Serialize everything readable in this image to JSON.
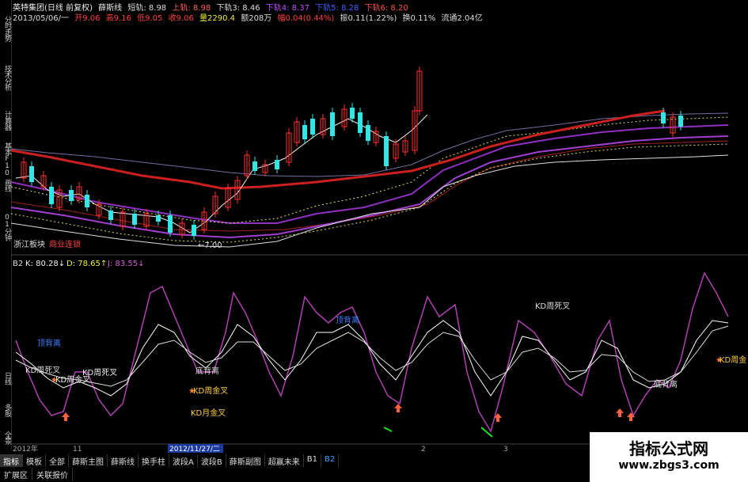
{
  "sidebar": [
    "分时走势",
    "技术分析",
    "计算器",
    "基本F10",
    "画线",
    "01分钟",
    "日线",
    "多股",
    "全景"
  ],
  "header": {
    "line1": [
      "英特集团(日线 前复权)",
      "薛斯线",
      "短轨: 8.98",
      "上轨: 8.98",
      "下轨3: 8.46",
      "下轨4: 8.37",
      "下轨5: 8.28",
      "下轨6: 8.20"
    ],
    "line2": [
      "2013/05/06/一",
      "开9.06",
      "高9.16",
      "低9.05",
      "收9.06",
      "量2290.4",
      "额208万",
      "幅0.04(0.44%)",
      "振0.11(1.22%)",
      "换0.11%",
      "流通2.04亿"
    ]
  },
  "price_labels": {
    "low": "←7.00",
    "sector": "浙江板块",
    "industry": "商业连锁"
  },
  "indicator_header": [
    "B2",
    "K: 80.28↓",
    "D: 78.65↑",
    "J: 83.55↓"
  ],
  "annotations": [
    "顶背离",
    "顶背离",
    "KD周死叉",
    "KD周死叉",
    "KD周金叉",
    "底背离",
    "KD周金叉",
    "KD月金叉",
    "KD周死叉",
    "底背离",
    "KD周金"
  ],
  "axis": {
    "year": "2012年",
    "m11": "11",
    "date_box": "2012/11/27/二",
    "m2": "2",
    "m3": "3"
  },
  "tabs": [
    "指标",
    "模板",
    "全部",
    "薛斯主图",
    "薛斯线",
    "换手柱",
    "波段A",
    "波段B",
    "薛斯副图",
    "超赢未来",
    "B1",
    "B2"
  ],
  "bottom": [
    "扩展区",
    "关联报价"
  ],
  "watermark": {
    "title": "指标公式网",
    "url": "www.zbgs3.com"
  },
  "colors": {
    "up": "#ff3030",
    "down": "#33e6e6",
    "k": "#ffffff",
    "j": "#c040c0",
    "mid": "#e03030"
  }
}
